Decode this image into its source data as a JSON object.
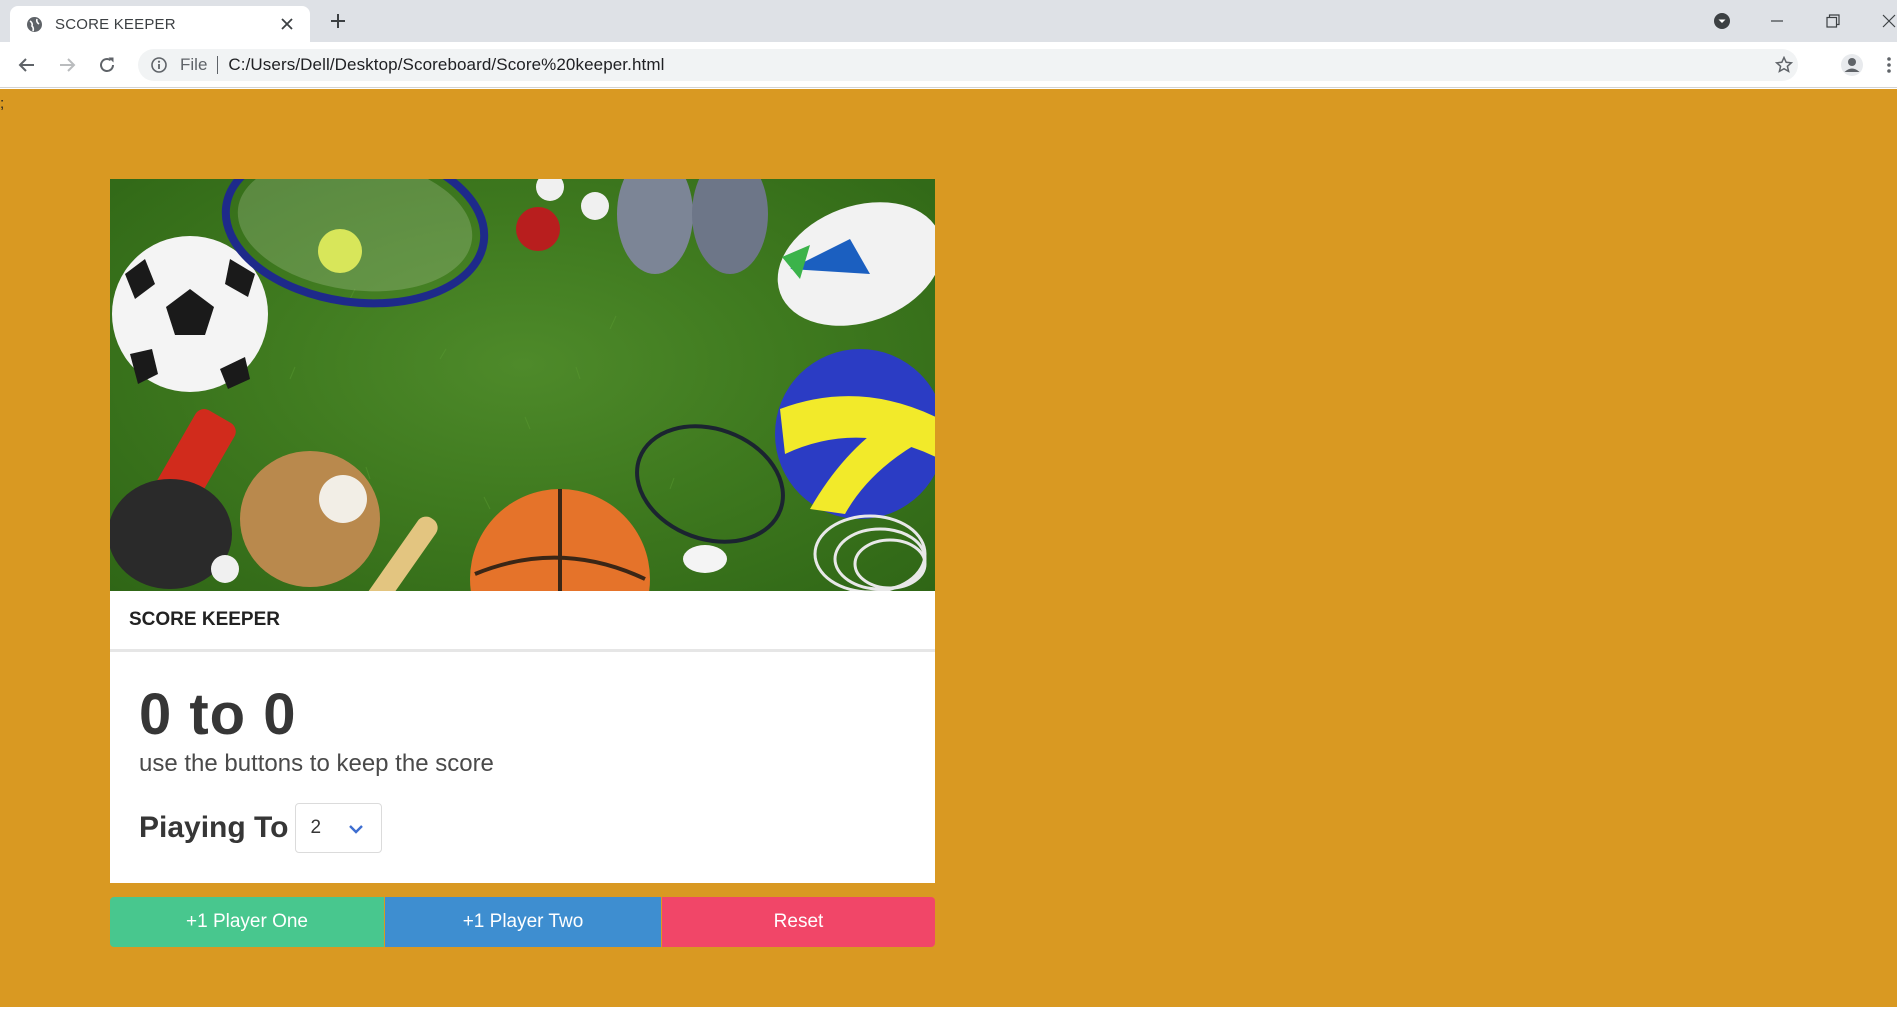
{
  "browser": {
    "tab_title": "SCORE KEEPER",
    "file_label": "File",
    "url": "C:/Users/Dell/Desktop/Scoreboard/Score%20keeper.html",
    "icons": {
      "tab_favicon": "globe-icon",
      "close": "close-icon",
      "new_tab": "plus-icon",
      "back": "arrow-left-icon",
      "forward": "arrow-right-icon",
      "reload": "reload-icon",
      "info": "info-icon",
      "bookmark": "star-icon",
      "profile": "user-icon",
      "menu": "kebab-menu-icon",
      "tab_search": "chevron-down-circle-icon",
      "minimize": "minimize-icon",
      "restore": "restore-icon",
      "window_close": "close-icon"
    }
  },
  "page": {
    "background_color": "#d99922",
    "stray_text": ";",
    "card": {
      "image_alt": "sports equipment on grass",
      "header_title": "SCORE KEEPER",
      "score": "0 to 0",
      "subtitle": "use the buttons to keep the score",
      "playing_to_label": "Piaying To",
      "playing_to_value": "2"
    },
    "buttons": {
      "player_one": "+1 Player One",
      "player_two": "+1 Player Two",
      "reset": "Reset"
    },
    "colors": {
      "player_one": "#48c78e",
      "player_two": "#3e8ed0",
      "reset": "#f14668"
    }
  }
}
